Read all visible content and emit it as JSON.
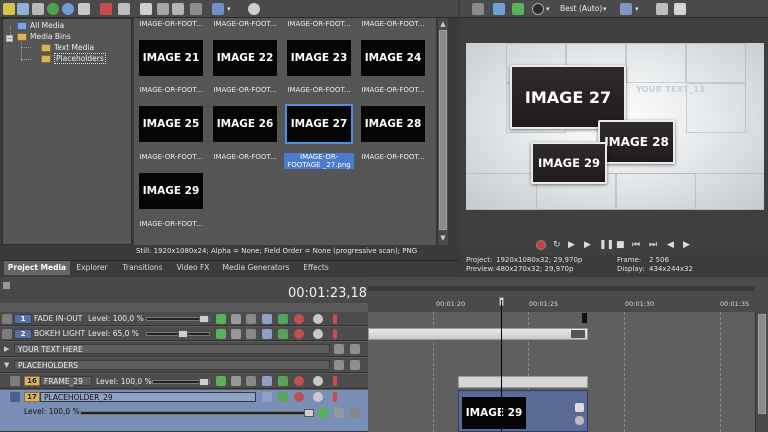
{
  "project_media": {
    "tree": [
      {
        "label": "All Media"
      },
      {
        "label": "Media Bins"
      },
      {
        "label": "Text Media"
      },
      {
        "label": "Placeholders"
      }
    ],
    "grid_items": [
      {
        "caption": "IMAGE-OR-FOOT...",
        "thumb": ""
      },
      {
        "caption": "IMAGE-OR-FOOT...",
        "thumb": ""
      },
      {
        "caption": "IMAGE-OR-FOOT...",
        "thumb": ""
      },
      {
        "caption": "IMAGE-OR-FOOT...",
        "thumb": ""
      },
      {
        "caption": "IMAGE-OR-FOOT...",
        "thumb": "IMAGE 21"
      },
      {
        "caption": "IMAGE-OR-FOOT...",
        "thumb": "IMAGE 22"
      },
      {
        "caption": "IMAGE-OR-FOOT...",
        "thumb": "IMAGE 23"
      },
      {
        "caption": "IMAGE-OR-FOOT...",
        "thumb": "IMAGE 24"
      },
      {
        "caption": "IMAGE-OR-FOOT...",
        "thumb": "IMAGE 25"
      },
      {
        "caption": "IMAGE-OR-FOOT...",
        "thumb": "IMAGE 26"
      },
      {
        "caption": "IMAGE-OR-FOOTAGE _27.png",
        "thumb": "IMAGE 27",
        "selected": true
      },
      {
        "caption": "IMAGE-OR-FOOT...",
        "thumb": "IMAGE 28"
      },
      {
        "caption": "IMAGE-OR-FOOT...",
        "thumb": "IMAGE 29"
      }
    ],
    "status": "Still: 1920x1080x24; Alpha = None; Field Order = None (progressive scan); PNG"
  },
  "tabs": [
    "Project Media",
    "Explorer",
    "Transitions",
    "Video FX",
    "Media Generators",
    "Effects"
  ],
  "preview": {
    "quality": "Best (Auto)",
    "scene": {
      "card_27": "IMAGE 27",
      "card_28": "IMAGE 28",
      "card_29": "IMAGE 29",
      "text_13": "YOUR TEXT_13"
    },
    "info": {
      "project_label": "Project:",
      "project_value": "1920x1080x32; 29,970p",
      "preview_label": "Preview:",
      "preview_value": "480x270x32; 29,970p",
      "frame_label": "Frame:",
      "frame_value": "2 506",
      "display_label": "Display:",
      "display_value": "434x244x32"
    }
  },
  "timeline": {
    "timecode": "00:01:23,18",
    "ruler": [
      "00:01:20",
      "00:01:25",
      "00:01:30",
      "00:01:35"
    ],
    "tracks": [
      {
        "num": "1",
        "name": "FADE IN-OUT",
        "level": "Level: 100,0 %"
      },
      {
        "num": "2",
        "name": "BOKEH LIGHT",
        "level": "Level: 65,0 %"
      },
      {
        "name": "YOUR TEXT HERE"
      },
      {
        "name": "PLACEHOLDERS"
      },
      {
        "num": "16",
        "name": "FRAME_29",
        "level": "Level: 100,0 %"
      },
      {
        "num": "17",
        "name": "PLACEHOLDER_29",
        "level": "Level: 100,0 %"
      }
    ],
    "clip_label": "IMAGE 29"
  },
  "colors": {
    "accent": "#3f74c6",
    "selection": "#7a8fb5",
    "track_num": "#d7b469",
    "playhead": "#000000"
  }
}
